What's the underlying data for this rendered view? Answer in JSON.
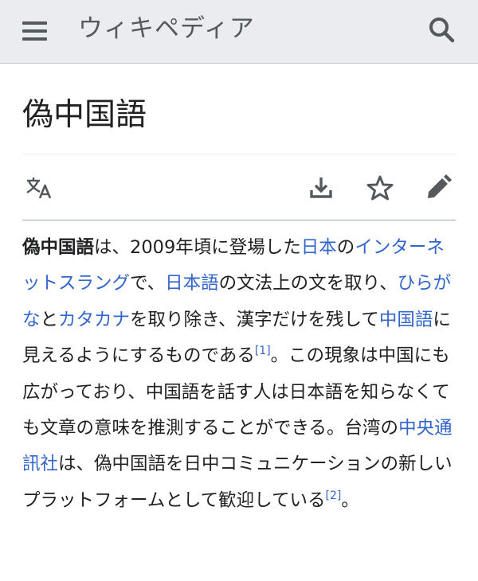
{
  "header": {
    "site_title": "ウィキペディア",
    "menu_icon": "hamburger-menu-icon",
    "search_icon": "search-icon"
  },
  "page": {
    "title": "偽中国語"
  },
  "toolbar": {
    "language_icon": "language-icon",
    "download_icon": "download-icon",
    "watch_icon": "star-icon",
    "edit_icon": "pencil-icon"
  },
  "article": {
    "term": "偽中国語",
    "t1": "は、2009年頃に登場した",
    "link_nihon": "日本",
    "t2": "の",
    "link_internet_slang": "インターネットスラング",
    "t3": "で、",
    "link_nihongo": "日本語",
    "t4": "の文法上の文を取り、",
    "link_hiragana": "ひらがな",
    "t5": "と",
    "link_katakana": "カタカナ",
    "t6": "を取り除き、漢字だけを残して",
    "link_chugokugo": "中国語",
    "t7": "に見えるようにするものである",
    "ref1": "[1]",
    "t8": "。この現象は中国にも広がっており、中国語を話す人は日本語を知らなくても文章の意味を推測することができる。台湾の",
    "link_cna": "中央通訊社",
    "t9": "は、偽中国語を日中コミュニケーションの新しいプラットフォームとして歓迎している",
    "ref2": "[2]",
    "t10": "。"
  },
  "colors": {
    "link": "#3366cc",
    "header_bg": "#eaecf0",
    "icon": "#54595d",
    "text": "#202122"
  }
}
